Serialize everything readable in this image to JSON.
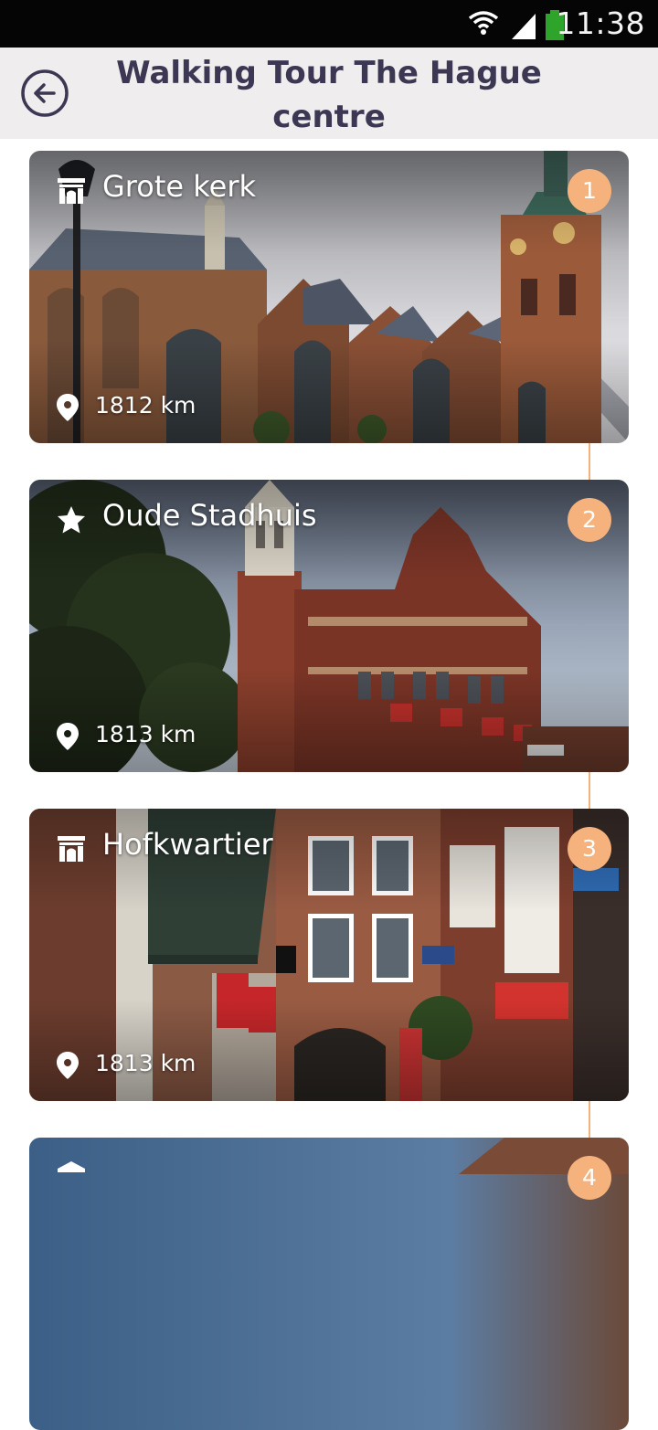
{
  "status_bar": {
    "time": "11:38"
  },
  "header": {
    "title_line1": "Walking Tour The Hague",
    "title_line2": "centre",
    "back_icon": "back-arrow-circle-icon"
  },
  "colors": {
    "accent": "#f6b27c",
    "title_text": "#3c3752",
    "header_bg": "#efeded"
  },
  "stops": [
    {
      "number": "1",
      "name": "Grote kerk",
      "distance": "1812 km",
      "icon": "monument-icon"
    },
    {
      "number": "2",
      "name": "Oude Stadhuis",
      "distance": "1813 km",
      "icon": "star-icon"
    },
    {
      "number": "3",
      "name": "Hofkwartier",
      "distance": "1813 km",
      "icon": "monument-icon"
    },
    {
      "number": "4",
      "name": "",
      "distance": "",
      "icon": "museum-icon"
    }
  ]
}
